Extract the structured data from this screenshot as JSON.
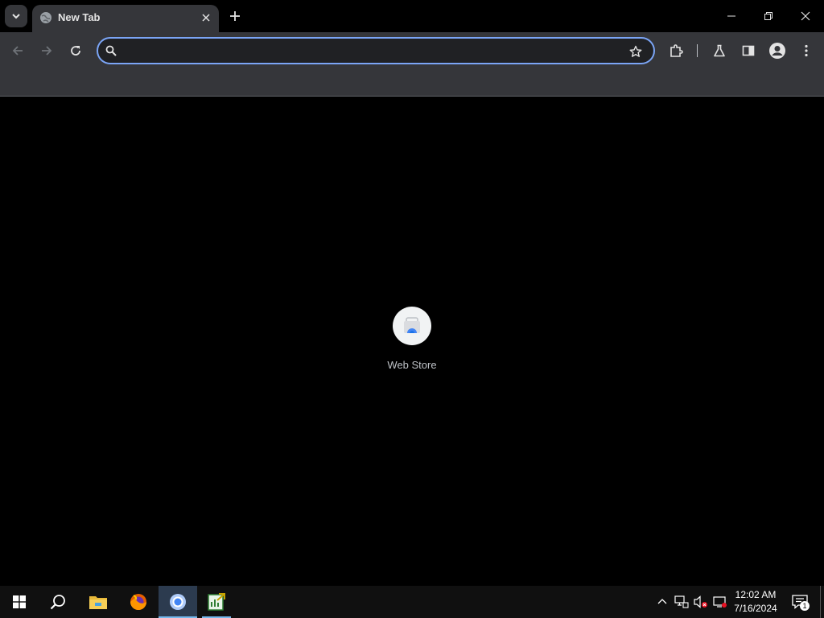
{
  "browser": {
    "tab": {
      "title": "New Tab",
      "favicon": "globe-icon"
    },
    "omnibox": {
      "value": "",
      "placeholder": ""
    },
    "toolbar_icons": [
      "back-icon",
      "forward-icon",
      "reload-icon",
      "bookmark-star-icon",
      "extensions-icon",
      "labs-icon",
      "side-panel-icon",
      "profile-icon",
      "menu-icon"
    ]
  },
  "newtab": {
    "shortcuts": [
      {
        "label": "Web Store",
        "icon": "web-store-icon"
      }
    ]
  },
  "taskbar": {
    "apps": [
      "windows-start-icon",
      "search-icon",
      "file-explorer-icon",
      "firefox-icon",
      "chrome-icon",
      "spreadsheet-app-icon"
    ],
    "clock": {
      "time": "12:02 AM",
      "date": "7/16/2024"
    },
    "notifications": {
      "count": "1"
    }
  },
  "colors": {
    "accent": "#7ba5f6",
    "toolbar": "#35363a",
    "background": "#000000"
  }
}
